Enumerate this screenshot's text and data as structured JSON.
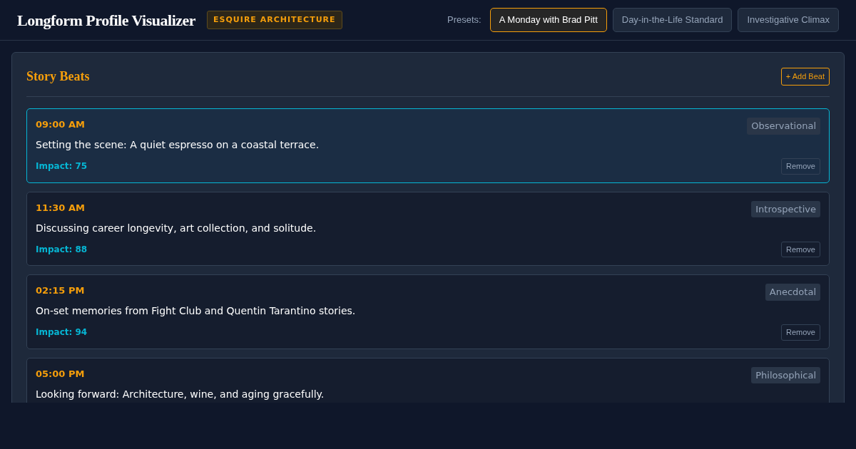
{
  "header": {
    "title": "Longform Profile Visualizer",
    "badge": "ESQUIRE ARCHITECTURE",
    "presets_label": "Presets:",
    "presets": [
      {
        "label": "A Monday with Brad Pitt",
        "selected": true
      },
      {
        "label": "Day-in-the-Life Standard",
        "selected": false
      },
      {
        "label": "Investigative Climax",
        "selected": false
      }
    ]
  },
  "panel": {
    "title": "Story Beats",
    "add_button": "+ Add Beat",
    "beats": [
      {
        "time": "09:00 AM",
        "tag": "Observational",
        "text": "Setting the scene: A quiet espresso on a coastal terrace.",
        "impact": "Impact: 75",
        "remove": "Remove",
        "selected": true
      },
      {
        "time": "11:30 AM",
        "tag": "Introspective",
        "text": "Discussing career longevity, art collection, and solitude.",
        "impact": "Impact: 88",
        "remove": "Remove",
        "selected": false
      },
      {
        "time": "02:15 PM",
        "tag": "Anecdotal",
        "text": "On-set memories from Fight Club and Quentin Tarantino stories.",
        "impact": "Impact: 94",
        "remove": "Remove",
        "selected": false
      },
      {
        "time": "05:00 PM",
        "tag": "Philosophical",
        "text": "Looking forward: Architecture, wine, and aging gracefully.",
        "selected": false
      }
    ]
  }
}
